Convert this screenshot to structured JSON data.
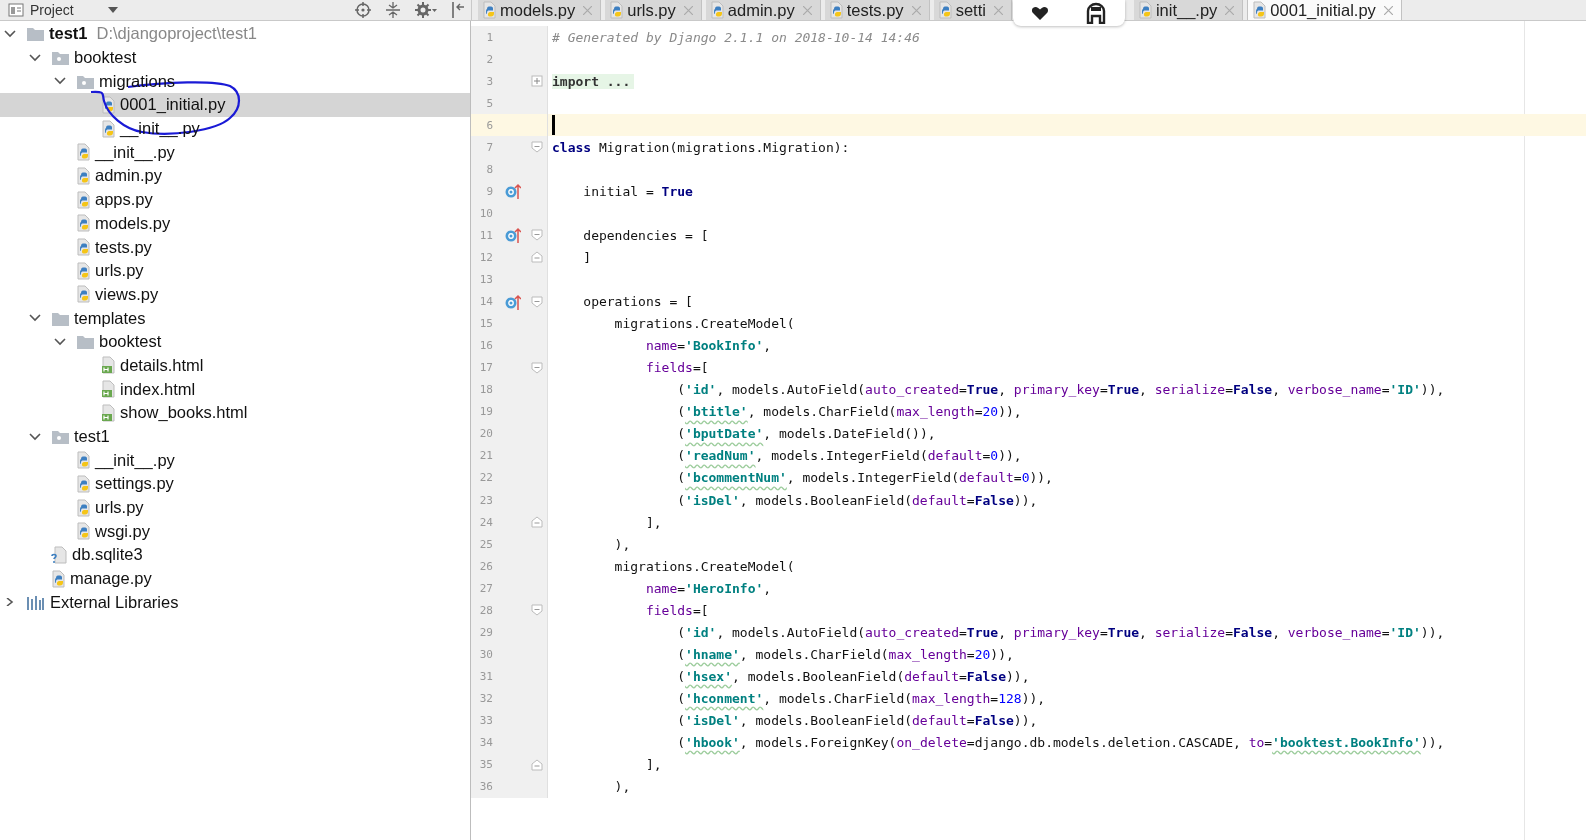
{
  "project_panel": {
    "title": "Project"
  },
  "tree": [
    {
      "label": "test1",
      "path": "D:\\djangoproject\\test1",
      "kind": "root",
      "expanded": true,
      "selected": false,
      "children": [
        {
          "label": "booktest",
          "kind": "package",
          "expanded": true,
          "selected": false,
          "children": [
            {
              "label": "migrations",
              "kind": "package",
              "expanded": true,
              "selected": false,
              "children": [
                {
                  "label": "0001_initial.py",
                  "kind": "python",
                  "selected": true
                },
                {
                  "label": "__init__.py",
                  "kind": "python",
                  "selected": false
                }
              ]
            },
            {
              "label": "__init__.py",
              "kind": "python",
              "selected": false
            },
            {
              "label": "admin.py",
              "kind": "python",
              "selected": false
            },
            {
              "label": "apps.py",
              "kind": "python",
              "selected": false
            },
            {
              "label": "models.py",
              "kind": "python",
              "selected": false
            },
            {
              "label": "tests.py",
              "kind": "python",
              "selected": false
            },
            {
              "label": "urls.py",
              "kind": "python",
              "selected": false
            },
            {
              "label": "views.py",
              "kind": "python",
              "selected": false
            }
          ]
        },
        {
          "label": "templates",
          "kind": "folder",
          "expanded": true,
          "selected": false,
          "children": [
            {
              "label": "booktest",
              "kind": "folder",
              "expanded": true,
              "selected": false,
              "children": [
                {
                  "label": "details.html",
                  "kind": "html",
                  "selected": false
                },
                {
                  "label": "index.html",
                  "kind": "html",
                  "selected": false
                },
                {
                  "label": "show_books.html",
                  "kind": "html",
                  "selected": false
                }
              ]
            }
          ]
        },
        {
          "label": "test1",
          "kind": "package",
          "expanded": true,
          "selected": false,
          "children": [
            {
              "label": "__init__.py",
              "kind": "python",
              "selected": false
            },
            {
              "label": "settings.py",
              "kind": "python",
              "selected": false
            },
            {
              "label": "urls.py",
              "kind": "python",
              "selected": false
            },
            {
              "label": "wsgi.py",
              "kind": "python",
              "selected": false
            }
          ]
        },
        {
          "label": "db.sqlite3",
          "kind": "database",
          "selected": false
        },
        {
          "label": "manage.py",
          "kind": "python",
          "selected": false
        }
      ]
    },
    {
      "label": "External Libraries",
      "kind": "libraries",
      "expanded": false,
      "selected": false
    }
  ],
  "tabs": [
    {
      "label": "models.py",
      "selected": false
    },
    {
      "label": "urls.py",
      "selected": false
    },
    {
      "label": "admin.py",
      "selected": false
    },
    {
      "label": "tests.py",
      "selected": false
    },
    {
      "label": "setti",
      "selected": false
    },
    {
      "label": "init__.py",
      "selected": false
    },
    {
      "label": "0001_initial.py",
      "selected": true
    }
  ],
  "editor": {
    "lines": [
      {
        "num": "1",
        "tokens": [
          {
            "kind": "comment",
            "text": "# Generated by Django 2.1.1 on 2018-10-14 14:46"
          }
        ]
      },
      {
        "num": "2"
      },
      {
        "num": "3",
        "folded": true,
        "tokens": [
          {
            "kind": "folded",
            "text": "import ..."
          }
        ]
      },
      {
        "num": "5"
      },
      {
        "num": "6",
        "current": true
      },
      {
        "num": "7",
        "fold_start": true,
        "tokens": [
          {
            "kind": "keyword",
            "text": "class"
          },
          {
            "kind": "plain",
            "text": " Migration(migrations.Migration):"
          }
        ]
      },
      {
        "num": "8"
      },
      {
        "num": "9",
        "marker": true,
        "tokens": [
          {
            "kind": "plain",
            "text": "    initial = "
          },
          {
            "kind": "keyword",
            "text": "True"
          }
        ]
      },
      {
        "num": "10"
      },
      {
        "num": "11",
        "marker": true,
        "fold_start": true,
        "tokens": [
          {
            "kind": "plain",
            "text": "    dependencies = ["
          }
        ]
      },
      {
        "num": "12",
        "fold_end": true,
        "tokens": [
          {
            "kind": "plain",
            "text": "    ]"
          }
        ]
      },
      {
        "num": "13"
      },
      {
        "num": "14",
        "marker": true,
        "fold_start": true,
        "tokens": [
          {
            "kind": "plain",
            "text": "    operations = ["
          }
        ]
      },
      {
        "num": "15",
        "tokens": [
          {
            "kind": "plain",
            "text": "        migrations.CreateModel("
          }
        ]
      },
      {
        "num": "16",
        "tokens": [
          {
            "kind": "param",
            "text": "            name"
          },
          {
            "kind": "plain",
            "text": "="
          },
          {
            "kind": "string",
            "text": "'BookInfo'"
          },
          {
            "kind": "plain",
            "text": ","
          }
        ]
      },
      {
        "num": "17",
        "fold_start": true,
        "tokens": [
          {
            "kind": "param",
            "text": "            fields"
          },
          {
            "kind": "plain",
            "text": "=["
          }
        ]
      },
      {
        "num": "18",
        "tokens": [
          {
            "kind": "plain",
            "text": "                ("
          },
          {
            "kind": "string",
            "text": "'id'"
          },
          {
            "kind": "plain",
            "text": ", models.AutoField("
          },
          {
            "kind": "param",
            "text": "auto_created"
          },
          {
            "kind": "plain",
            "text": "="
          },
          {
            "kind": "keyword",
            "text": "True"
          },
          {
            "kind": "plain",
            "text": ", "
          },
          {
            "kind": "param",
            "text": "primary_key"
          },
          {
            "kind": "plain",
            "text": "="
          },
          {
            "kind": "keyword",
            "text": "True"
          },
          {
            "kind": "plain",
            "text": ", "
          },
          {
            "kind": "param",
            "text": "serialize"
          },
          {
            "kind": "plain",
            "text": "="
          },
          {
            "kind": "keyword",
            "text": "False"
          },
          {
            "kind": "plain",
            "text": ", "
          },
          {
            "kind": "param",
            "text": "verbose_name"
          },
          {
            "kind": "plain",
            "text": "="
          },
          {
            "kind": "string",
            "text": "'ID'"
          },
          {
            "kind": "plain",
            "text": ")),"
          }
        ]
      },
      {
        "num": "19",
        "tokens": [
          {
            "kind": "plain",
            "text": "                ("
          },
          {
            "kind": "typo",
            "text": "'btitle'"
          },
          {
            "kind": "plain",
            "text": ", models.CharField("
          },
          {
            "kind": "param",
            "text": "max_length"
          },
          {
            "kind": "plain",
            "text": "="
          },
          {
            "kind": "number",
            "text": "20"
          },
          {
            "kind": "plain",
            "text": ")),"
          }
        ]
      },
      {
        "num": "20",
        "tokens": [
          {
            "kind": "plain",
            "text": "                ("
          },
          {
            "kind": "typo",
            "text": "'bputDate'"
          },
          {
            "kind": "plain",
            "text": ", models.DateField()),"
          }
        ]
      },
      {
        "num": "21",
        "tokens": [
          {
            "kind": "plain",
            "text": "                ("
          },
          {
            "kind": "typo",
            "text": "'readNum'"
          },
          {
            "kind": "plain",
            "text": ", models.IntegerField("
          },
          {
            "kind": "param",
            "text": "default"
          },
          {
            "kind": "plain",
            "text": "="
          },
          {
            "kind": "number",
            "text": "0"
          },
          {
            "kind": "plain",
            "text": ")),"
          }
        ]
      },
      {
        "num": "22",
        "tokens": [
          {
            "kind": "plain",
            "text": "                ("
          },
          {
            "kind": "typo",
            "text": "'bcommentNum'"
          },
          {
            "kind": "plain",
            "text": ", models.IntegerField("
          },
          {
            "kind": "param",
            "text": "default"
          },
          {
            "kind": "plain",
            "text": "="
          },
          {
            "kind": "number",
            "text": "0"
          },
          {
            "kind": "plain",
            "text": ")),"
          }
        ]
      },
      {
        "num": "23",
        "tokens": [
          {
            "kind": "plain",
            "text": "                ("
          },
          {
            "kind": "string",
            "text": "'isDel'"
          },
          {
            "kind": "plain",
            "text": ", models.BooleanField("
          },
          {
            "kind": "param",
            "text": "default"
          },
          {
            "kind": "plain",
            "text": "="
          },
          {
            "kind": "keyword",
            "text": "False"
          },
          {
            "kind": "plain",
            "text": ")),"
          }
        ]
      },
      {
        "num": "24",
        "fold_end": true,
        "tokens": [
          {
            "kind": "plain",
            "text": "            ],"
          }
        ]
      },
      {
        "num": "25",
        "tokens": [
          {
            "kind": "plain",
            "text": "        ),"
          }
        ]
      },
      {
        "num": "26",
        "tokens": [
          {
            "kind": "plain",
            "text": "        migrations.CreateModel("
          }
        ]
      },
      {
        "num": "27",
        "tokens": [
          {
            "kind": "param",
            "text": "            name"
          },
          {
            "kind": "plain",
            "text": "="
          },
          {
            "kind": "string",
            "text": "'HeroInfo'"
          },
          {
            "kind": "plain",
            "text": ","
          }
        ]
      },
      {
        "num": "28",
        "fold_start": true,
        "tokens": [
          {
            "kind": "param",
            "text": "            fields"
          },
          {
            "kind": "plain",
            "text": "=["
          }
        ]
      },
      {
        "num": "29",
        "tokens": [
          {
            "kind": "plain",
            "text": "                ("
          },
          {
            "kind": "string",
            "text": "'id'"
          },
          {
            "kind": "plain",
            "text": ", models.AutoField("
          },
          {
            "kind": "param",
            "text": "auto_created"
          },
          {
            "kind": "plain",
            "text": "="
          },
          {
            "kind": "keyword",
            "text": "True"
          },
          {
            "kind": "plain",
            "text": ", "
          },
          {
            "kind": "param",
            "text": "primary_key"
          },
          {
            "kind": "plain",
            "text": "="
          },
          {
            "kind": "keyword",
            "text": "True"
          },
          {
            "kind": "plain",
            "text": ", "
          },
          {
            "kind": "param",
            "text": "serialize"
          },
          {
            "kind": "plain",
            "text": "="
          },
          {
            "kind": "keyword",
            "text": "False"
          },
          {
            "kind": "plain",
            "text": ", "
          },
          {
            "kind": "param",
            "text": "verbose_name"
          },
          {
            "kind": "plain",
            "text": "="
          },
          {
            "kind": "string",
            "text": "'ID'"
          },
          {
            "kind": "plain",
            "text": ")),"
          }
        ]
      },
      {
        "num": "30",
        "tokens": [
          {
            "kind": "plain",
            "text": "                ("
          },
          {
            "kind": "typo",
            "text": "'hname'"
          },
          {
            "kind": "plain",
            "text": ", models.CharField("
          },
          {
            "kind": "param",
            "text": "max_length"
          },
          {
            "kind": "plain",
            "text": "="
          },
          {
            "kind": "number",
            "text": "20"
          },
          {
            "kind": "plain",
            "text": ")),"
          }
        ]
      },
      {
        "num": "31",
        "tokens": [
          {
            "kind": "plain",
            "text": "                ("
          },
          {
            "kind": "typo",
            "text": "'hsex'"
          },
          {
            "kind": "plain",
            "text": ", models.BooleanField("
          },
          {
            "kind": "param",
            "text": "default"
          },
          {
            "kind": "plain",
            "text": "="
          },
          {
            "kind": "keyword",
            "text": "False"
          },
          {
            "kind": "plain",
            "text": ")),"
          }
        ]
      },
      {
        "num": "32",
        "tokens": [
          {
            "kind": "plain",
            "text": "                ("
          },
          {
            "kind": "typo",
            "text": "'hconment'"
          },
          {
            "kind": "plain",
            "text": ", models.CharField("
          },
          {
            "kind": "param",
            "text": "max_length"
          },
          {
            "kind": "plain",
            "text": "="
          },
          {
            "kind": "number",
            "text": "128"
          },
          {
            "kind": "plain",
            "text": ")),"
          }
        ]
      },
      {
        "num": "33",
        "tokens": [
          {
            "kind": "plain",
            "text": "                ("
          },
          {
            "kind": "string",
            "text": "'isDel'"
          },
          {
            "kind": "plain",
            "text": ", models.BooleanField("
          },
          {
            "kind": "param",
            "text": "default"
          },
          {
            "kind": "plain",
            "text": "="
          },
          {
            "kind": "keyword",
            "text": "False"
          },
          {
            "kind": "plain",
            "text": ")),"
          }
        ]
      },
      {
        "num": "34",
        "tokens": [
          {
            "kind": "plain",
            "text": "                ("
          },
          {
            "kind": "typo",
            "text": "'hbook'"
          },
          {
            "kind": "plain",
            "text": ", models.ForeignKey("
          },
          {
            "kind": "param",
            "text": "on_delete"
          },
          {
            "kind": "plain",
            "text": "=django.db.models.deletion.CASCADE, "
          },
          {
            "kind": "param",
            "text": "to"
          },
          {
            "kind": "plain",
            "text": "="
          },
          {
            "kind": "typo",
            "text": "'booktest.BookInfo'"
          },
          {
            "kind": "plain",
            "text": ")),"
          }
        ]
      },
      {
        "num": "35",
        "fold_end": true,
        "tokens": [
          {
            "kind": "plain",
            "text": "            ],"
          }
        ]
      },
      {
        "num": "36",
        "tokens": [
          {
            "kind": "plain",
            "text": "        ),"
          }
        ]
      }
    ]
  }
}
